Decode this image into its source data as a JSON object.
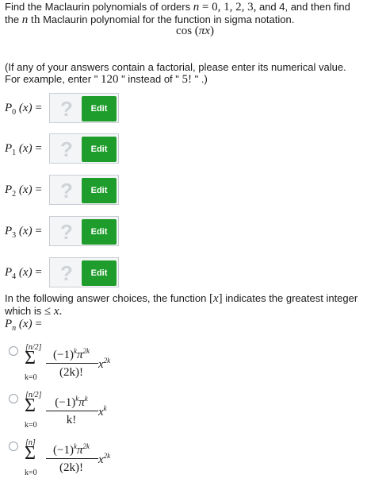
{
  "prompt": {
    "line1": "Find the Maclaurin polynomials of orders n = 0, 1, 2, 3, and 4, and then find",
    "line2": "the n th Maclaurin polynomial for the function in sigma notation.",
    "function": "cos (πx)"
  },
  "note": {
    "line1": "(If any of your answers contain a factorial, please enter its numerical value.",
    "line2": "For example, enter \" 120 \" instead of \" 5! \" .)"
  },
  "polynomials": [
    {
      "label": "P",
      "sub": "0",
      "rest": "(x) =",
      "placeholder": "?",
      "edit_label": "Edit"
    },
    {
      "label": "P",
      "sub": "1",
      "rest": "(x) =",
      "placeholder": "?",
      "edit_label": "Edit"
    },
    {
      "label": "P",
      "sub": "2",
      "rest": "(x) =",
      "placeholder": "?",
      "edit_label": "Edit"
    },
    {
      "label": "P",
      "sub": "3",
      "rest": "(x) =",
      "placeholder": "?",
      "edit_label": "Edit"
    },
    {
      "label": "P",
      "sub": "4",
      "rest": "(x) =",
      "placeholder": "?",
      "edit_label": "Edit"
    }
  ],
  "choices_intro": {
    "line1": "In the following answer choices, the function [x] indicates the greatest integer",
    "line2": "which is ≤ x.",
    "pn": "Pn (x) ="
  },
  "choices": [
    {
      "upper": "[n/2]",
      "sigma": "Σ",
      "lower": "k=0",
      "numerator": "(−1)kπ2k",
      "denominator": "(2k)!",
      "x_power": "x2k"
    },
    {
      "upper": "[n/2]",
      "sigma": "Σ",
      "lower": "k=0",
      "numerator": "(−1)kπk",
      "denominator": "k!",
      "x_power": "xk"
    },
    {
      "upper": "[n]",
      "sigma": "Σ",
      "lower": "k=0",
      "numerator": "(−1)kπ2k",
      "denominator": "(2k)!",
      "x_power": "x2k"
    }
  ]
}
